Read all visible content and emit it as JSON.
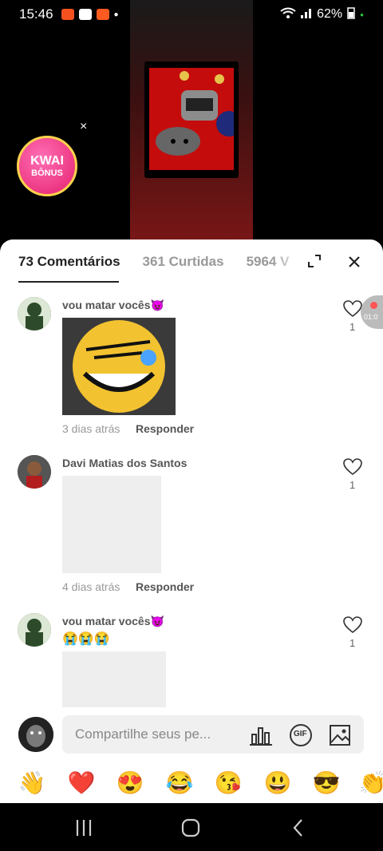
{
  "status": {
    "time": "15:46",
    "battery": "62%"
  },
  "overlay": {
    "bonus_line1": "KWAI",
    "bonus_line2": "BÔNUS",
    "close": "×"
  },
  "tabs": [
    {
      "label": "73 Comentários"
    },
    {
      "label": "361 Curtidas"
    },
    {
      "label": "5964 V"
    }
  ],
  "comments": [
    {
      "name": "vou matar vocês😈",
      "text": "",
      "time": "3 dias atrás",
      "reply": "Responder",
      "likes": "1"
    },
    {
      "name": "Davi Matias dos Santos",
      "text": "",
      "time": "4 dias atrás",
      "reply": "Responder",
      "likes": "1"
    },
    {
      "name": "vou matar vocês😈",
      "text": "😭😭😭",
      "time": "",
      "reply": "",
      "likes": "1"
    }
  ],
  "recording": {
    "time": "01:0"
  },
  "input": {
    "placeholder": "Compartilhe seus pe...",
    "gif_label": "GIF"
  },
  "emojis": [
    "👋",
    "❤️",
    "😍",
    "😂",
    "😘",
    "😃",
    "😎",
    "👏"
  ],
  "colors": {
    "accent": "#222222",
    "muted": "#999999",
    "sheet_bg": "#ffffff"
  }
}
